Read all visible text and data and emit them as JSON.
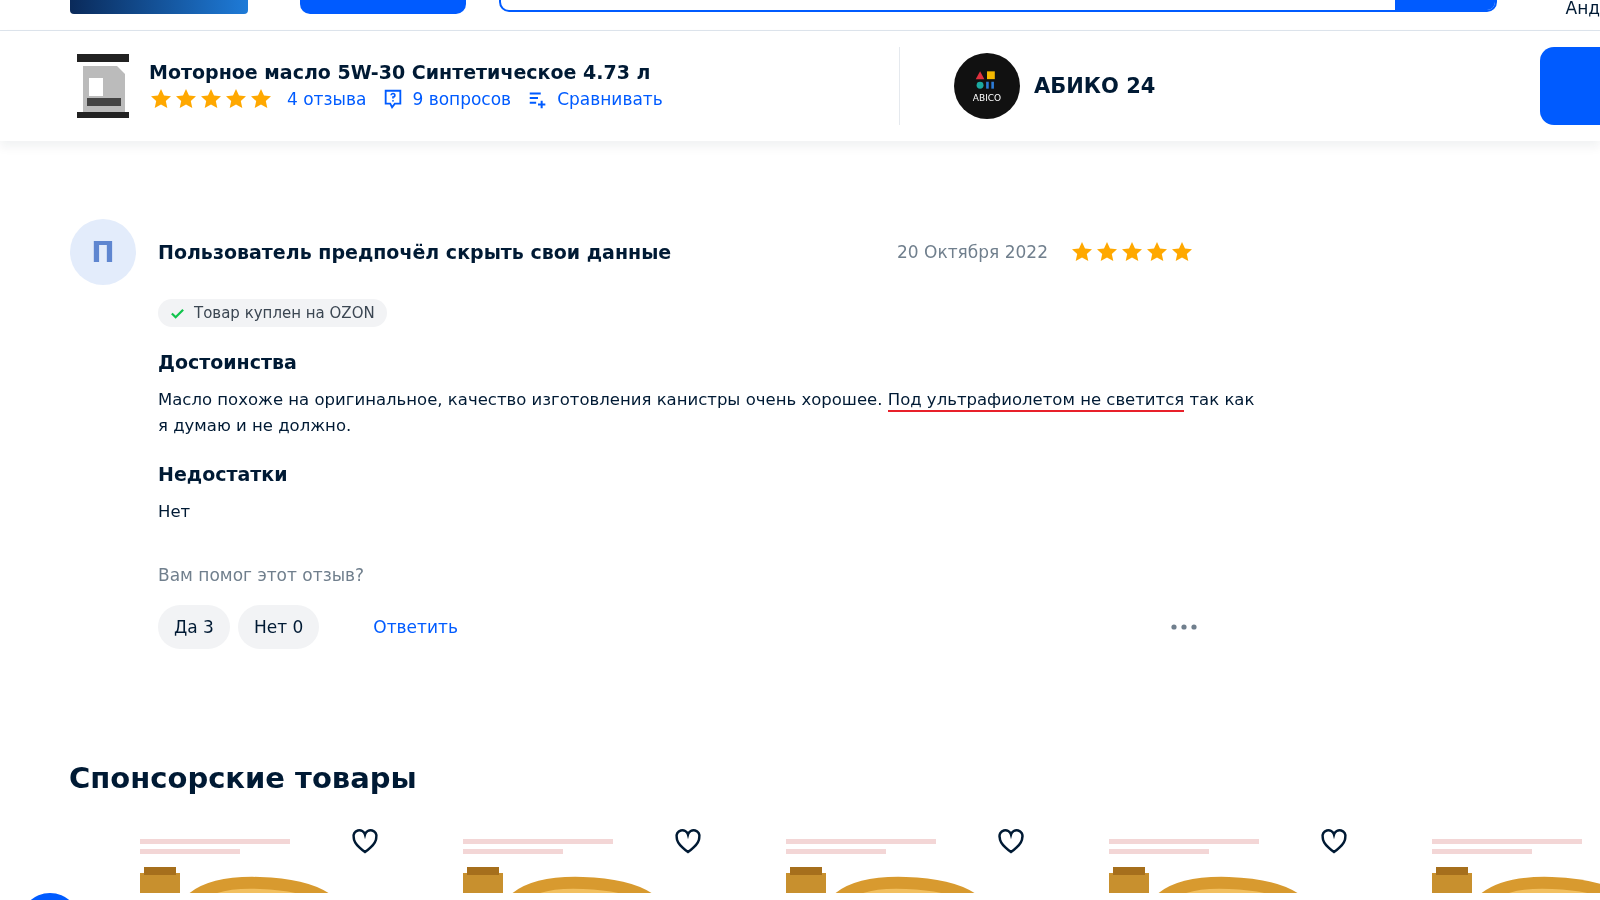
{
  "top_bar": {
    "user_name": "Анд"
  },
  "product_bar": {
    "title": "Моторное масло 5W-30 Синтетическое 4.73 л",
    "stars": 5,
    "reviews": "4 отзыва",
    "questions": "9 вопросов",
    "compare": "Сравнивать",
    "seller_logo": "ABICO",
    "seller": "АБИКО 24"
  },
  "review": {
    "avatar_letter": "П",
    "author": "Пользователь предпочёл скрыть свои данные",
    "date": "20 Октября 2022",
    "stars": 5,
    "badge": "Товар куплен на OZON",
    "pros_title": "Достоинства",
    "pros_parts": [
      {
        "text": "Масло похоже на оригинальное, качество изготовления канистры очень хорошее. ",
        "underlined": false
      },
      {
        "text": "Под ультрафиолетом не светится",
        "underlined": true
      },
      {
        "text": " так как я думаю и не должно.",
        "underlined": false
      }
    ],
    "cons_title": "Недостатки",
    "cons": "Нет",
    "helpful_question": "Вам помог этот отзыв?",
    "yes": "Да 3",
    "no": "Нет 0",
    "reply": "Ответить"
  },
  "sponsored": {
    "title": "Спонсорские товары",
    "items": [
      {
        "kind": "card"
      },
      {
        "kind": "card"
      },
      {
        "kind": "card"
      },
      {
        "kind": "card"
      },
      {
        "kind": "picture"
      }
    ]
  }
}
